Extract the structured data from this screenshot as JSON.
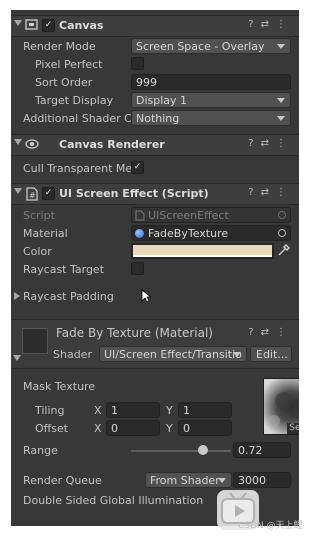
{
  "canvas": {
    "title": "Canvas",
    "enabled": true,
    "render_mode_label": "Render Mode",
    "render_mode_value": "Screen Space - Overlay",
    "pixel_perfect_label": "Pixel Perfect",
    "sort_order_label": "Sort Order",
    "sort_order_value": "999",
    "target_display_label": "Target Display",
    "target_display_value": "Display 1",
    "additional_shader_label": "Additional Shader Ch",
    "additional_shader_value": "Nothing"
  },
  "canvas_renderer": {
    "title": "Canvas Renderer",
    "cull_label": "Cull Transparent Me",
    "cull_checked": true
  },
  "ui_effect": {
    "title": "UI Screen Effect (Script)",
    "enabled": true,
    "script_label": "Script",
    "script_value": "UIScreenEffect",
    "material_label": "Material",
    "material_value": "FadeByTexture",
    "color_label": "Color",
    "color_swatch": "#e8d8b8",
    "raycast_target_label": "Raycast Target",
    "raycast_padding_label": "Raycast Padding"
  },
  "material": {
    "title": "Fade By Texture (Material)",
    "shader_label": "Shader",
    "shader_value": "UI/Screen Effect/Transitio",
    "edit_label": "Edit...",
    "mask_texture_label": "Mask Texture",
    "tiling_label": "Tiling",
    "tiling_x_label": "X",
    "tiling_x": "1",
    "tiling_y_label": "Y",
    "tiling_y": "1",
    "offset_label": "Offset",
    "offset_x_label": "X",
    "offset_x": "0",
    "offset_y_label": "Y",
    "offset_y": "0",
    "select_label": "Select",
    "range_label": "Range",
    "range_value": "0.72",
    "range_fraction": 0.72,
    "render_queue_label": "Render Queue",
    "render_queue_mode": "From Shader",
    "render_queue_value": "3000",
    "double_sided_label": "Double Sided Global Illumination"
  },
  "watermark": "CSDN @天上鲤"
}
